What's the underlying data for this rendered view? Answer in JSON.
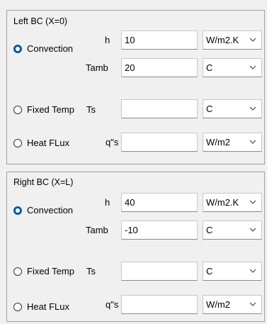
{
  "left": {
    "title": "Left BC (X=0)",
    "convection": {
      "label": "Convection",
      "selected": true,
      "h_label": "h",
      "h_value": "10",
      "h_unit": "W/m2.K",
      "tamb_label": "Tamb",
      "tamb_value": "20",
      "tamb_unit": "C"
    },
    "fixed": {
      "label": "Fixed Temp",
      "selected": false,
      "ts_label": "Ts",
      "ts_value": "",
      "ts_unit": "C"
    },
    "flux": {
      "label": "Heat FLux",
      "selected": false,
      "q_label": "q\"s",
      "q_value": "",
      "q_unit": "W/m2"
    }
  },
  "right": {
    "title": "Right BC (X=L)",
    "convection": {
      "label": "Convection",
      "selected": true,
      "h_label": "h",
      "h_value": "40",
      "h_unit": "W/m2.K",
      "tamb_label": "Tamb",
      "tamb_value": "-10",
      "tamb_unit": "C"
    },
    "fixed": {
      "label": "Fixed Temp",
      "selected": false,
      "ts_label": "Ts",
      "ts_value": "",
      "ts_unit": "C"
    },
    "flux": {
      "label": "Heat FLux",
      "selected": false,
      "q_label": "q\"s",
      "q_value": "",
      "q_unit": "W/m2"
    }
  }
}
